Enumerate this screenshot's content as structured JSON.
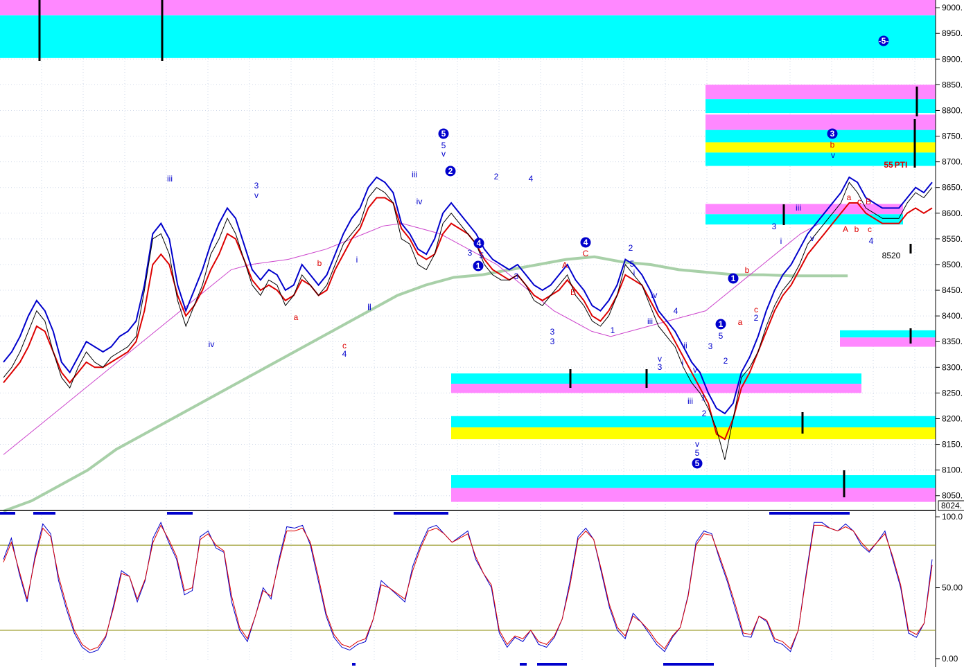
{
  "chart_data": [
    {
      "type": "line",
      "panel": "price",
      "ylim": [
        8024,
        9015
      ],
      "y_ticks": [
        "9000.",
        "8950.",
        "8900.",
        "8850.",
        "8800.",
        "8750.",
        "8700.",
        "8650.",
        "8600.",
        "8550.",
        "8500.",
        "8450.",
        "8400.",
        "8350.",
        "8300.",
        "8250.",
        "8200.",
        "8150.",
        "8100.",
        "8050."
      ],
      "y_tick_values": [
        9000,
        8950,
        8900,
        8850,
        8800,
        8750,
        8700,
        8650,
        8600,
        8550,
        8500,
        8450,
        8400,
        8350,
        8300,
        8250,
        8200,
        8150,
        8100,
        8050
      ],
      "last_price_label": "8024.",
      "grid": true,
      "x_index_range": [
        0,
        330
      ],
      "series": [
        {
          "values": [
            8280,
            8300,
            8330,
            8370,
            8410,
            8390,
            8330,
            8280,
            8260,
            8300,
            8330,
            8310,
            8300,
            8320,
            8330,
            8340,
            8360,
            8450,
            8550,
            8560,
            8520,
            8430,
            8380,
            8420,
            8460,
            8520,
            8550,
            8590,
            8560,
            8510,
            8460,
            8440,
            8470,
            8460,
            8420,
            8440,
            8480,
            8460,
            8440,
            8460,
            8500,
            8540,
            8560,
            8580,
            8630,
            8650,
            8640,
            8620,
            8550,
            8540,
            8500,
            8490,
            8520,
            8580,
            8600,
            8580,
            8560,
            8540,
            8500,
            8480,
            8470,
            8470,
            8480,
            8460,
            8430,
            8420,
            8440,
            8460,
            8480,
            8440,
            8420,
            8390,
            8380,
            8400,
            8440,
            8500,
            8480,
            8460,
            8420,
            8380,
            8360,
            8340,
            8300,
            8270,
            8250,
            8220,
            8180,
            8120,
            8200,
            8280,
            8300,
            8330,
            8380,
            8420,
            8450,
            8470,
            8500,
            8540,
            8560,
            8580,
            8600,
            8620,
            8660,
            8640,
            8610,
            8600,
            8590,
            8590,
            8590,
            8620,
            8640,
            8630,
            8650
          ]
        },
        {
          "values": [
            8310,
            8330,
            8360,
            8400,
            8430,
            8410,
            8370,
            8310,
            8290,
            8320,
            8350,
            8340,
            8330,
            8340,
            8360,
            8370,
            8390,
            8460,
            8560,
            8580,
            8550,
            8460,
            8410,
            8450,
            8490,
            8540,
            8580,
            8610,
            8590,
            8540,
            8490,
            8470,
            8490,
            8480,
            8450,
            8460,
            8500,
            8480,
            8460,
            8480,
            8520,
            8560,
            8590,
            8610,
            8650,
            8670,
            8660,
            8640,
            8580,
            8560,
            8530,
            8520,
            8550,
            8600,
            8620,
            8600,
            8580,
            8560,
            8530,
            8510,
            8500,
            8490,
            8500,
            8480,
            8460,
            8450,
            8460,
            8480,
            8500,
            8470,
            8450,
            8420,
            8410,
            8430,
            8460,
            8510,
            8500,
            8480,
            8450,
            8410,
            8390,
            8370,
            8340,
            8310,
            8290,
            8250,
            8220,
            8210,
            8230,
            8290,
            8320,
            8360,
            8410,
            8450,
            8480,
            8500,
            8530,
            8560,
            8580,
            8600,
            8620,
            8640,
            8670,
            8660,
            8630,
            8620,
            8610,
            8610,
            8610,
            8630,
            8650,
            8640,
            8660
          ],
          "color": "#0000cc"
        },
        {
          "values": [
            8270,
            8290,
            8310,
            8340,
            8380,
            8370,
            8330,
            8290,
            8270,
            8290,
            8310,
            8300,
            8300,
            8310,
            8320,
            8330,
            8350,
            8410,
            8500,
            8520,
            8500,
            8440,
            8400,
            8420,
            8450,
            8490,
            8520,
            8560,
            8550,
            8510,
            8470,
            8450,
            8460,
            8450,
            8430,
            8440,
            8470,
            8460,
            8440,
            8450,
            8490,
            8520,
            8550,
            8570,
            8610,
            8630,
            8630,
            8620,
            8570,
            8550,
            8520,
            8510,
            8520,
            8560,
            8580,
            8570,
            8560,
            8540,
            8510,
            8490,
            8480,
            8470,
            8480,
            8460,
            8440,
            8430,
            8440,
            8450,
            8470,
            8450,
            8430,
            8400,
            8390,
            8410,
            8440,
            8480,
            8470,
            8460,
            8430,
            8400,
            8380,
            8350,
            8320,
            8290,
            8260,
            8230,
            8170,
            8160,
            8200,
            8260,
            8290,
            8330,
            8370,
            8410,
            8440,
            8460,
            8490,
            8520,
            8540,
            8560,
            8580,
            8600,
            8620,
            8620,
            8600,
            8590,
            8580,
            8580,
            8580,
            8600,
            8610,
            8600,
            8610
          ],
          "color": "#dd0000"
        },
        {
          "values": [
            8020,
            8040,
            8070,
            8100,
            8140,
            8170,
            8200,
            8230,
            8260,
            8290,
            8320,
            8350,
            8380,
            8410,
            8440,
            8460,
            8475,
            8480,
            8490,
            8500,
            8510,
            8515,
            8505,
            8500,
            8490,
            8485,
            8480,
            8480,
            8478,
            8478,
            8478
          ],
          "color": "#a8d0a8"
        },
        {
          "values": [
            8130,
            8160,
            8190,
            8220,
            8250,
            8280,
            8310,
            8340,
            8370,
            8400,
            8430,
            8460,
            8490,
            8500,
            8505,
            8510,
            8520,
            8530,
            8545,
            8560,
            8575,
            8580,
            8570,
            8560,
            8540,
            8520,
            8500,
            8470,
            8440,
            8410,
            8390,
            8370,
            8360,
            8370,
            8380,
            8390,
            8400,
            8410,
            8440,
            8470,
            8500,
            8530,
            8560,
            8580
          ],
          "color": "#cc44cc"
        }
      ],
      "annotations": [
        "5",
        "5",
        "v",
        "iii",
        "3",
        "v",
        "iv",
        "ii",
        "iii",
        "iv",
        "2",
        "2",
        "4",
        "1",
        "5",
        "3",
        "3",
        "4",
        "4",
        "A",
        "C",
        "B",
        "2",
        "i",
        "iv",
        "1",
        "3",
        "3",
        "5",
        "a",
        "b",
        "c",
        "4",
        "i",
        "ii",
        "iii",
        "v",
        "3",
        "4",
        "ii",
        "i",
        "v",
        "iii",
        "1",
        "2",
        "v",
        "5",
        "5",
        "1",
        "5",
        "3",
        "2",
        "1",
        "b",
        "a",
        "c",
        "2",
        "3",
        "i",
        "iii",
        "v",
        "3",
        "b",
        "v",
        "a",
        "c",
        "B",
        "A",
        "b",
        "c",
        "4",
        "-5-",
        "55",
        "PTI",
        "8520"
      ],
      "zones": [
        {
          "top": 9015,
          "bottom": 8985,
          "color": "#ff88ff"
        },
        {
          "top": 8985,
          "bottom": 8902,
          "color": "#00ffff"
        },
        {
          "top": 8850,
          "bottom": 8822,
          "color": "#ff88ff"
        },
        {
          "top": 8822,
          "bottom": 8795,
          "color": "#00ffff"
        },
        {
          "top": 8792,
          "bottom": 8762,
          "color": "#ff88ff"
        },
        {
          "top": 8762,
          "bottom": 8738,
          "color": "#00ffff"
        },
        {
          "top": 8738,
          "bottom": 8718,
          "color": "#ffff00"
        },
        {
          "top": 8718,
          "bottom": 8692,
          "color": "#00ffff"
        },
        {
          "top": 8618,
          "bottom": 8598,
          "color": "#ff88ff"
        },
        {
          "top": 8598,
          "bottom": 8578,
          "color": "#00ffff"
        },
        {
          "top": 8372,
          "bottom": 8358,
          "color": "#00ffff"
        },
        {
          "top": 8358,
          "bottom": 8340,
          "color": "#ff88ff"
        },
        {
          "top": 8288,
          "bottom": 8268,
          "color": "#00ffff"
        },
        {
          "top": 8268,
          "bottom": 8250,
          "color": "#ff88ff"
        },
        {
          "top": 8205,
          "bottom": 8183,
          "color": "#00ffff"
        },
        {
          "top": 8183,
          "bottom": 8160,
          "color": "#ffff00"
        },
        {
          "top": 8090,
          "bottom": 8065,
          "color": "#00ffff"
        },
        {
          "top": 8065,
          "bottom": 8038,
          "color": "#ff88ff"
        }
      ]
    },
    {
      "type": "line",
      "panel": "oscillator",
      "ylim": [
        -2,
        103
      ],
      "y_ticks": [
        "100.0",
        "50.00",
        "0.00"
      ],
      "y_tick_values": [
        100,
        50,
        0
      ],
      "reference_lines": [
        80,
        20
      ],
      "series": [
        {
          "values": [
            70,
            85,
            60,
            40,
            72,
            95,
            88,
            55,
            35,
            18,
            8,
            4,
            6,
            15,
            38,
            62,
            58,
            40,
            55,
            85,
            96,
            82,
            70,
            45,
            48,
            86,
            90,
            78,
            75,
            40,
            20,
            12,
            30,
            50,
            42,
            70,
            93,
            92,
            94,
            80,
            55,
            30,
            15,
            8,
            6,
            10,
            12,
            28,
            55,
            50,
            45,
            40,
            65,
            80,
            92,
            94,
            88,
            82,
            86,
            90,
            70,
            60,
            50,
            18,
            8,
            15,
            12,
            20,
            10,
            8,
            15,
            28,
            55,
            86,
            92,
            84,
            60,
            36,
            20,
            14,
            32,
            26,
            18,
            10,
            5,
            15,
            22,
            45,
            82,
            90,
            88,
            70,
            54,
            35,
            16,
            15,
            30,
            26,
            12,
            10,
            5,
            20,
            60,
            96,
            96,
            92,
            90,
            95,
            90,
            80,
            75,
            82,
            90,
            70,
            50,
            18,
            15,
            25,
            70
          ],
          "color": "#0000cc"
        },
        {
          "values": [
            68,
            82,
            62,
            42,
            70,
            92,
            86,
            58,
            38,
            20,
            10,
            6,
            8,
            16,
            36,
            60,
            58,
            42,
            56,
            82,
            94,
            84,
            72,
            48,
            50,
            84,
            88,
            80,
            76,
            44,
            22,
            14,
            30,
            48,
            44,
            68,
            90,
            90,
            92,
            82,
            58,
            32,
            17,
            10,
            8,
            12,
            14,
            28,
            52,
            50,
            46,
            42,
            62,
            78,
            90,
            92,
            88,
            82,
            85,
            88,
            72,
            60,
            52,
            20,
            10,
            16,
            14,
            20,
            12,
            10,
            16,
            28,
            52,
            84,
            90,
            84,
            62,
            38,
            22,
            16,
            30,
            26,
            20,
            12,
            7,
            16,
            22,
            44,
            80,
            88,
            87,
            72,
            56,
            38,
            18,
            17,
            30,
            27,
            14,
            12,
            7,
            20,
            58,
            94,
            94,
            92,
            90,
            93,
            90,
            82,
            76,
            82,
            88,
            72,
            52,
            20,
            17,
            25,
            66
          ],
          "color": "#dd0000"
        }
      ]
    }
  ],
  "colors": {
    "axis": "#000000",
    "grid": "#cfd8e8",
    "price_up": "#0000cc",
    "price_down": "#dd0000",
    "osc_ref": "#888800",
    "separator": "#000000"
  }
}
